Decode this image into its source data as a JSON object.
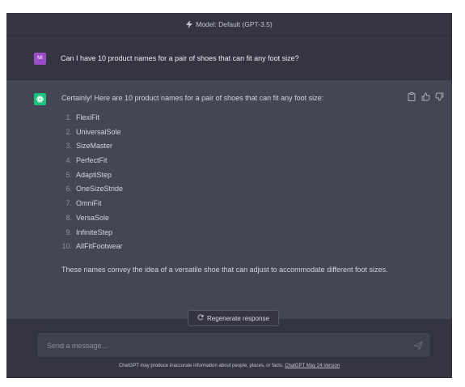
{
  "header": {
    "model_label": "Model: Default (GPT-3.5)"
  },
  "user_message": {
    "avatar_initials": "MI",
    "text": "Can I have 10 product names for a pair of shoes that can fit any foot size?"
  },
  "assistant_message": {
    "intro": "Certainly! Here are 10 product names for a pair of shoes that can fit any foot size:",
    "items": [
      {
        "num": "1.",
        "name": "FlexiFit"
      },
      {
        "num": "2.",
        "name": "UniversalSole"
      },
      {
        "num": "3.",
        "name": "SizeMaster"
      },
      {
        "num": "4.",
        "name": "PerfectFit"
      },
      {
        "num": "5.",
        "name": "AdaptiStep"
      },
      {
        "num": "6.",
        "name": "OneSizeStride"
      },
      {
        "num": "7.",
        "name": "OmniFit"
      },
      {
        "num": "8.",
        "name": "VersaSole"
      },
      {
        "num": "9.",
        "name": "InfiniteStep"
      },
      {
        "num": "10.",
        "name": "AllFitFootwear"
      }
    ],
    "outro": "These names convey the idea of a versatile shoe that can adjust to accommodate different foot sizes.",
    "action_icons": [
      "clipboard-icon",
      "thumbs-up-icon",
      "thumbs-down-icon"
    ]
  },
  "regenerate": {
    "label": "Regenerate response"
  },
  "composer": {
    "placeholder": "Send a message..."
  },
  "footer": {
    "disclaimer": "ChatGPT may produce inaccurate information about people, places, or facts.",
    "version_link": "ChatGPT May 24 Version"
  },
  "colors": {
    "background": "#343541",
    "assistant_background": "#444654",
    "user_avatar": "#9a4dc7",
    "assistant_avatar": "#19c37d"
  }
}
